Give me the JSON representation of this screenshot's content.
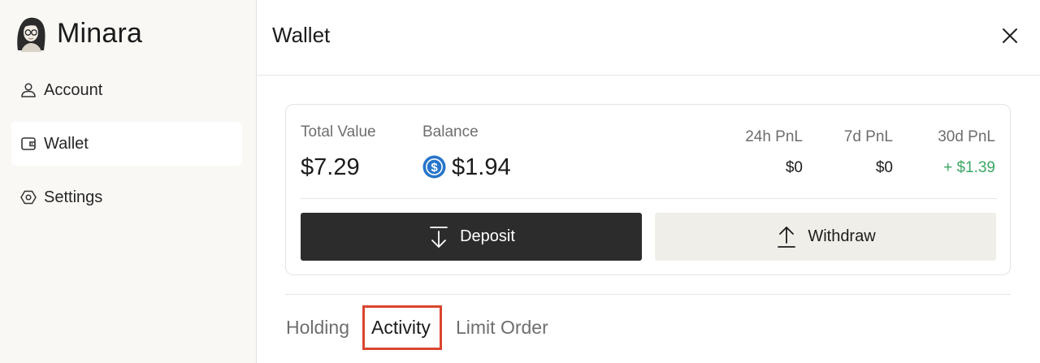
{
  "sidebar": {
    "brand": "Minara",
    "items": [
      {
        "label": "Account",
        "icon": "user-icon"
      },
      {
        "label": "Wallet",
        "icon": "wallet-icon",
        "active": true
      },
      {
        "label": "Settings",
        "icon": "settings-icon"
      }
    ]
  },
  "header": {
    "title": "Wallet",
    "close_icon": "close-icon"
  },
  "summary": {
    "total_value_label": "Total Value",
    "total_value": "$7.29",
    "balance_label": "Balance",
    "balance": "$1.94",
    "balance_icon": "usdc-coin-icon",
    "pnl": [
      {
        "label": "24h PnL",
        "value": "$0"
      },
      {
        "label": "7d PnL",
        "value": "$0"
      },
      {
        "label": "30d PnL",
        "value": "+ $1.39",
        "positive": true
      }
    ]
  },
  "actions": {
    "deposit_label": "Deposit",
    "withdraw_label": "Withdraw"
  },
  "tabs": [
    {
      "label": "Holding"
    },
    {
      "label": "Activity",
      "active": true
    },
    {
      "label": "Limit Order"
    }
  ],
  "colors": {
    "accent_dark": "#2c2c2c",
    "positive": "#3aa865",
    "highlight": "#d9452e",
    "usdc_blue": "#2775ca"
  }
}
